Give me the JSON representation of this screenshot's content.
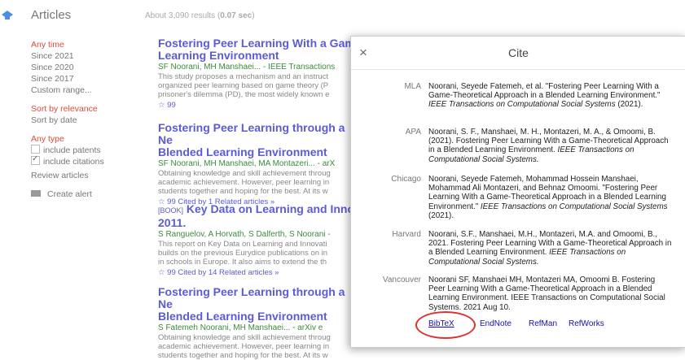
{
  "header": {
    "title": "Articles",
    "results_prefix": "About 3,090 results (",
    "results_time": "0.07 sec",
    "results_suffix": ")"
  },
  "sidebar": {
    "time_items": [
      "Any time",
      "Since 2021",
      "Since 2020",
      "Since 2017",
      "Custom range..."
    ],
    "sort_items": [
      "Sort by relevance",
      "Sort by date"
    ],
    "type_label": "Any type",
    "include_patents": "include patents",
    "include_citations": "include citations",
    "review_articles": "Review articles",
    "create_alert": "Create alert"
  },
  "results": [
    {
      "title_bold": "Fostering",
      "title_rest": " Peer Learning With a Game",
      "title_line2": "Learning Environment",
      "authors": "SF Noorani, MH Manshaei... - IEEE Transactions",
      "snippet": [
        "This study proposes a mechanism and an instruct",
        "organized peer learning based on game theory (P",
        "prisoner's dilemma (PD), the most widely known e"
      ],
      "links": "☆  99"
    },
    {
      "title_bold": "Fostering",
      "title_rest": " Peer Learning through a Ne",
      "title_line2": "Blended Learning Environment",
      "authors": "SF Noorani, MH Manshaei, MA Montazeri... - arX",
      "snippet": [
        "Obtaining knowledge and skill achievement throug",
        "academic achievement. However, peer learning in",
        "students together and hoping for the best. At its w"
      ],
      "links": "☆  99  Cited by 1  Related articles  »"
    },
    {
      "tag": "[BOOK]",
      "title_rest": " Key Data on Learning and Innov",
      "title_line2": "2011.",
      "authors": "S Ranguelov, A Horvath, S Dalferth, S Noorani -",
      "snippet": [
        "This report on Key Data on Learning and Innovati",
        "builds on the previous Eurydice publications on in",
        "in schools in Europe. It also aims to extend the th"
      ],
      "links": "☆  99  Cited by 14  Related articles  »"
    },
    {
      "title_bold": "Fostering",
      "title_rest": " Peer Learning through a Ne",
      "title_line2": "Blended Learning Environment",
      "authors": "S Fatemeh Noorani, MH Manshaei... - arXiv e",
      "snippet": [
        "Obtaining knowledge and skill achievement throug",
        "academic achievement. However, peer learning in",
        "students together and hoping for the best. At its w"
      ],
      "links": "☆  99"
    }
  ],
  "dialog": {
    "title": "Cite",
    "close": "×",
    "citations": [
      {
        "style": "MLA",
        "text": "Noorani, Seyede Fatemeh, et al. \"Fostering Peer Learning With a Game-Theoretical Approach in a Blended Learning Environment.\" ",
        "italic": "IEEE Transactions on Computational Social Systems",
        "tail": " (2021)."
      },
      {
        "style": "APA",
        "text": "Noorani, S. F., Manshaei, M. H., Montazeri, M. A., & Omoomi, B. (2021). Fostering Peer Learning With a Game-Theoretical Approach in a Blended Learning Environment. ",
        "italic": "IEEE Transactions on Computational Social Systems.",
        "tail": ""
      },
      {
        "style": "Chicago",
        "text": "Noorani, Seyede Fatemeh, Mohammad Hossein Manshaei, Mohammad Ali Montazeri, and Behnaz Omoomi. \"Fostering Peer Learning With a Game-Theoretical Approach in a Blended Learning Environment.\" ",
        "italic": "IEEE Transactions on Computational Social Systems",
        "tail": " (2021)."
      },
      {
        "style": "Harvard",
        "text": "Noorani, S.F., Manshaei, M.H., Montazeri, M.A. and Omoomi, B., 2021. Fostering Peer Learning With a Game-Theoretical Approach in a Blended Learning Environment. ",
        "italic": "IEEE Transactions on Computational Social Systems.",
        "tail": ""
      },
      {
        "style": "Vancouver",
        "text": "Noorani SF, Manshaei MH, Montazeri MA, Omoomi B. Fostering Peer Learning With a Game-Theoretical Approach in a Blended Learning Environment. IEEE Transactions on Computational Social Systems. 2021 Aug 10.",
        "italic": "",
        "tail": ""
      }
    ],
    "formats": [
      "BibTeX",
      "EndNote",
      "RefMan",
      "RefWorks"
    ]
  }
}
